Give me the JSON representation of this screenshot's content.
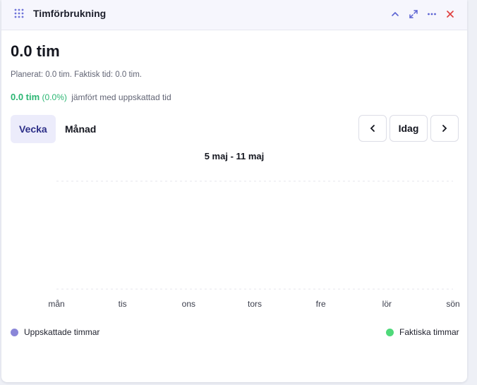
{
  "header": {
    "title": "Timförbrukning",
    "icons": [
      "drag-handle-icon",
      "collapse-chevron-up-icon",
      "expand-icon",
      "more-dots-icon",
      "close-icon"
    ]
  },
  "summary": {
    "total": "0.0 tim",
    "planned_actual": "Planerat: 0.0 tim. Faktisk tid: 0.0 tim.",
    "diff_value": "0.0 tim",
    "diff_percent": "(0.0%)",
    "diff_text": "jämfört med uppskattad tid"
  },
  "tabs": {
    "week": "Vecka",
    "month": "Månad",
    "active": "week"
  },
  "nav": {
    "prev_icon": "chevron-left-icon",
    "today": "Idag",
    "next_icon": "chevron-right-icon"
  },
  "range_label": "5 maj - 11 maj",
  "chart_data": {
    "type": "bar",
    "categories": [
      "mån",
      "tis",
      "ons",
      "tors",
      "fre",
      "lör",
      "sön"
    ],
    "series": [
      {
        "name": "Uppskattade timmar",
        "values": [
          0,
          0,
          0,
          0,
          0,
          0,
          0
        ],
        "color": "#8a86d8"
      },
      {
        "name": "Faktiska timmar",
        "values": [
          0,
          0,
          0,
          0,
          0,
          0,
          0
        ],
        "color": "#4fd97a"
      }
    ],
    "grid": true
  },
  "colors": {
    "accent": "#2d2f88",
    "positive": "#2bb673",
    "close": "#e04040",
    "icon": "#5b63d3"
  }
}
